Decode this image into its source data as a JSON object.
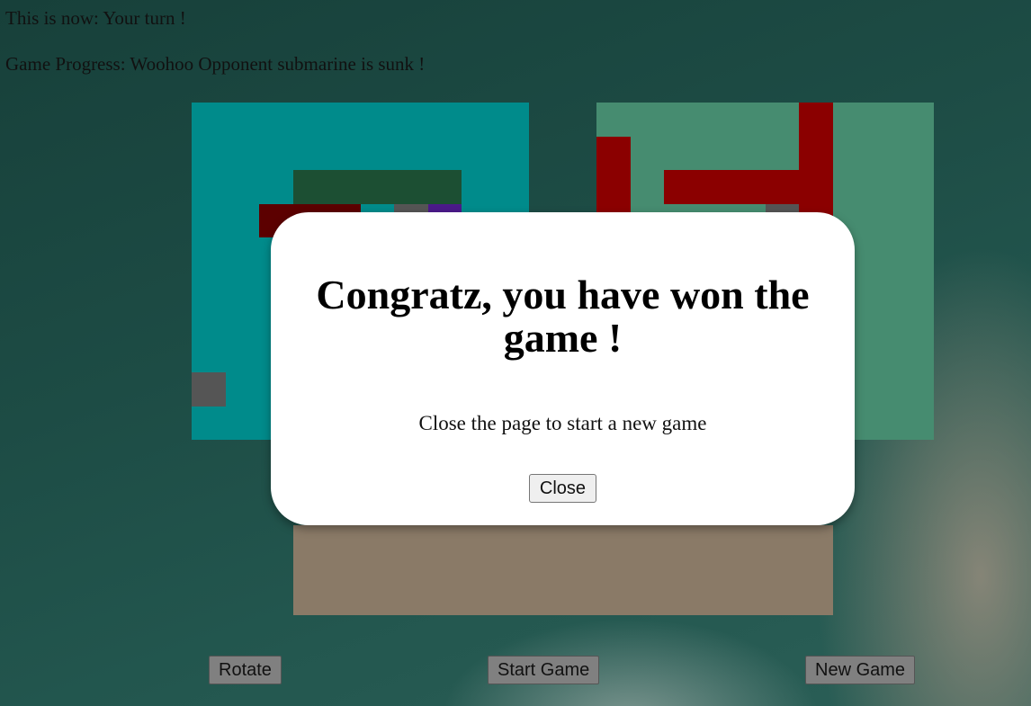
{
  "status": {
    "turn_text": "This is now: Your turn !",
    "progress_text": "Game Progress: Woohoo Opponent submarine is sunk !"
  },
  "boards": {
    "player": {
      "background": "#008b8b"
    },
    "opponent": {
      "background": "#468c70"
    },
    "dock": {
      "background": "#8a7a67"
    }
  },
  "colors": {
    "sunk": "#8b0000",
    "ship_green": "#1c4f33",
    "ship_darkred": "#5c0000",
    "ship_gray": "#555555",
    "ship_purple": "#4b1a8a"
  },
  "buttons": {
    "rotate": "Rotate",
    "start": "Start Game",
    "new_game": "New Game"
  },
  "modal": {
    "title": "Congratz, you have won the game !",
    "message": "Close the page to start a new game",
    "close": "Close"
  }
}
